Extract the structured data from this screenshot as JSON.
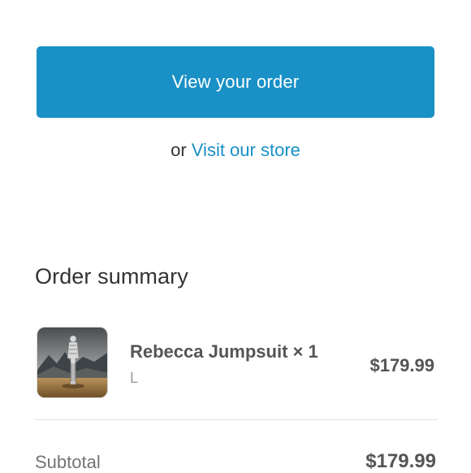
{
  "actions": {
    "view_order_label": "View your order",
    "alt_prefix": "or",
    "visit_store_label": "Visit our store"
  },
  "summary": {
    "title": "Order summary",
    "items": [
      {
        "name": "Rebecca Jumpsuit × 1",
        "variant": "L",
        "price": "$179.99",
        "thumbnail_icon": "product-photo"
      }
    ],
    "subtotal_label": "Subtotal",
    "subtotal_value": "$179.99"
  },
  "colors": {
    "accent": "#1990c6",
    "text": "#333333",
    "muted": "#737373",
    "divider": "#e1e1e1"
  }
}
